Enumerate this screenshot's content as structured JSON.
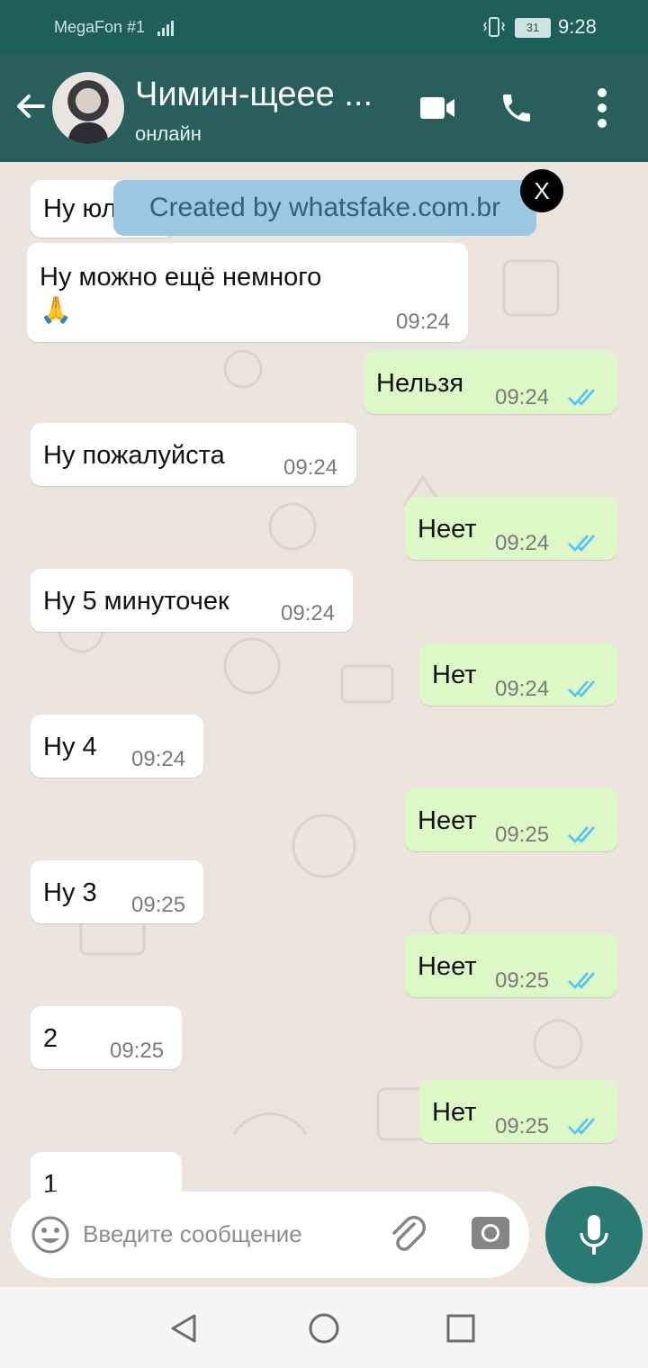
{
  "status_bar": {
    "carrier": "MegaFon #1",
    "battery": "31",
    "time": "9:28"
  },
  "header": {
    "contact_name": "Чимин-щеее ...",
    "status": "онлайн"
  },
  "banner": {
    "text": "Created by whatsfake.com.br",
    "close_label": "X"
  },
  "messages": [
    {
      "dir": "in",
      "text": "Ну юл",
      "time": ""
    },
    {
      "dir": "in",
      "text": "Ну можно ещё немного",
      "emoji": "🙏",
      "time": "09:24"
    },
    {
      "dir": "out",
      "text": "Нельзя",
      "time": "09:24"
    },
    {
      "dir": "in",
      "text": "Ну пожалуйста",
      "time": "09:24"
    },
    {
      "dir": "out",
      "text": "Неет",
      "time": "09:24"
    },
    {
      "dir": "in",
      "text": "Ну 5 минуточек",
      "time": "09:24"
    },
    {
      "dir": "out",
      "text": "Нет",
      "time": "09:24"
    },
    {
      "dir": "in",
      "text": "Ну 4",
      "time": "09:24"
    },
    {
      "dir": "out",
      "text": "Неет",
      "time": "09:25"
    },
    {
      "dir": "in",
      "text": "Ну 3",
      "time": "09:25"
    },
    {
      "dir": "out",
      "text": "Неет",
      "time": "09:25"
    },
    {
      "dir": "in",
      "text": "2",
      "time": "09:25"
    },
    {
      "dir": "out",
      "text": "Нет",
      "time": "09:25"
    },
    {
      "dir": "in",
      "text": "1",
      "time": ""
    }
  ],
  "input": {
    "placeholder": "Введите сообщение"
  },
  "colors": {
    "header": "#285e5b",
    "outgoing": "#dcf8c6",
    "incoming": "#ffffff",
    "ticks": "#4fc3f7",
    "mic": "#2a7a74"
  },
  "icons": [
    "back-arrow-icon",
    "video-call-icon",
    "phone-icon",
    "more-vert-icon",
    "emoji-icon",
    "attach-icon",
    "camera-icon",
    "mic-icon",
    "nav-back-icon",
    "nav-home-icon",
    "nav-recents-icon"
  ]
}
